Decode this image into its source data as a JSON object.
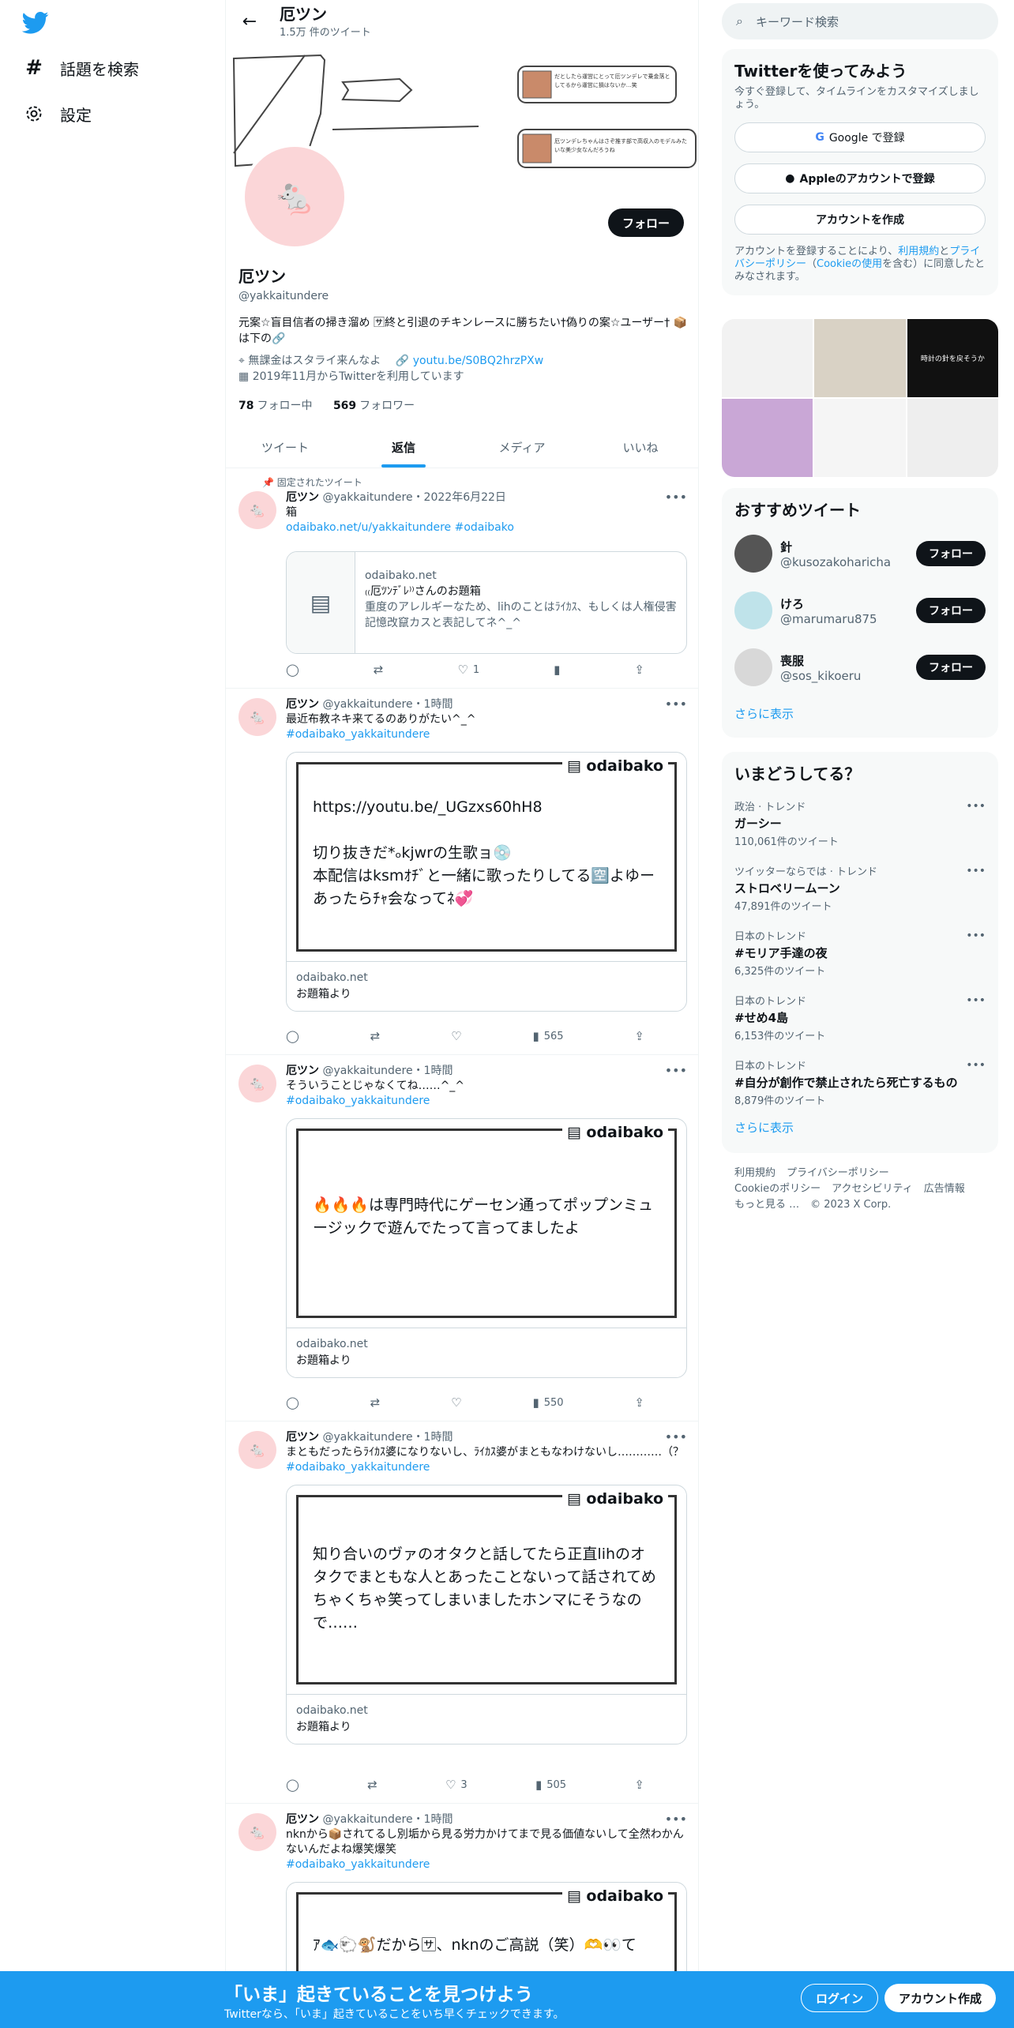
{
  "nav": {
    "explore_label": "話題を検索",
    "settings_label": "設定"
  },
  "header": {
    "name": "厄ツン",
    "tweet_count": "1.5万 件のツイート"
  },
  "profile": {
    "avatar_glyph": "🐁",
    "follow_label": "フォロー",
    "name": "厄ツン",
    "handle": "@yakkaitundere",
    "bio": "元案☆盲目信者の掃き溜め 🈂終と引退のチキンレースに勝ちたい†偽りの案☆ユーザー† 📦は下の🔗",
    "location": "無課金はスタライ来んなよ",
    "url": "youtu.be/S0BQ2hrzPXw",
    "joined": "2019年11月からTwitterを利用しています",
    "following_count": "78",
    "following_label": "フォロー中",
    "followers_count": "569",
    "followers_label": "フォロワー"
  },
  "banner": {
    "note1": "だとしたら運営にとって厄ツンデレで乗金落としてるから運営に損はないか…笑",
    "note2": "厄ツンデレちゃんはさぞ推す部で高収入のモデルみたいな美少女なんだろうね"
  },
  "tabs": [
    "ツイート",
    "返信",
    "メディア",
    "いいね"
  ],
  "pinned_label": "固定されたツイート",
  "tweets": [
    {
      "name": "厄ツン",
      "handle": "@yakkaitundere",
      "time": "・2022年6月22日",
      "text": "箱",
      "link": "odaibako.net/u/yakkaitundere",
      "tag": "#odaibako",
      "card_domain": "odaibako.net",
      "card_title": "₍₍厄ﾂﾝﾃﾞﾚ⁾⁾さんのお題箱",
      "card_desc": "重度のアレルギーなため、lihのことはﾗｲｶｽ、もしくは人権侵害記憶改竄カスと表記してネ^_^",
      "likes": "1"
    },
    {
      "name": "厄ツン",
      "handle": "@yakkaitundere",
      "time": "・1時間",
      "text": "最近布教ネキ来てるのありがたい^_^",
      "tag": "#odaibako_yakkaitundere",
      "brand": "odaibako",
      "ob_text": "https://youtu.be/_UGzxs60hH8\n\n切り抜きだ*ₒkjwrの生歌ョ💿\n本配信はksmｵﾁﾞと一緒に歌ったりしてる🈳よゆーあったらﾁｬ会なってﾈ💞",
      "card_domain": "odaibako.net",
      "card_title": "お題箱より",
      "views": "565"
    },
    {
      "name": "厄ツン",
      "handle": "@yakkaitundere",
      "time": "・1時間",
      "text": "そういうことじゃなくてね……^_^",
      "tag": "#odaibako_yakkaitundere",
      "brand": "odaibako",
      "ob_text": "🔥🔥🔥は専門時代にゲーセン通ってポップンミュージックで遊んでたって言ってましたよ",
      "card_domain": "odaibako.net",
      "card_title": "お題箱より",
      "views": "550"
    },
    {
      "name": "厄ツン",
      "handle": "@yakkaitundere",
      "time": "・1時間",
      "text": "まともだったらﾗｲｶｽ婆になりないし、ﾗｲｶｽ婆がまともなわけないし…………（？",
      "tag": "#odaibako_yakkaitundere",
      "brand": "odaibako",
      "ob_text": "知り合いのヴァのオタクと話してたら正直lihのオタクでまともな人とあったことないって話されてめちゃくちゃ笑ってしまいましたホンマにそうなので……",
      "card_domain": "odaibako.net",
      "card_title": "お題箱より",
      "likes": "3",
      "views": "505"
    },
    {
      "name": "厄ツン",
      "handle": "@yakkaitundere",
      "time": "・1時間",
      "text": "nknから📦されてるし別垢から見る労力かけてまで見る価値ないして全然わかんないんだよね爆笑爆笑",
      "tag": "#odaibako_yakkaitundere",
      "brand": "odaibako",
      "ob_text": "ｱ🐟🐑🐒だから🈂、nknのご高説（笑）🫶👀て"
    }
  ],
  "search": {
    "placeholder": "キーワード検索"
  },
  "signup_panel": {
    "title": "Twitterを使ってみよう",
    "subtitle": "今すぐ登録して、タイムラインをカスタマイズしましょう。",
    "google_label": "Google で登録",
    "apple_label": "Appleのアカウントで登録",
    "create_label": "アカウントを作成",
    "legal_1": "アカウントを登録することにより、",
    "legal_terms": "利用規約",
    "legal_2": "と",
    "legal_privacy": "プライバシーポリシー",
    "legal_3": "（",
    "legal_cookie": "Cookieの使用",
    "legal_4": "を含む）に同意したとみなされます。"
  },
  "media_tiles": [
    "時計の針を戻そうか"
  ],
  "recommend": {
    "title": "おすすめツイート",
    "users": [
      {
        "name": "針",
        "handle": "@kusozakoharicha",
        "follow": "フォロー"
      },
      {
        "name": "けろ",
        "handle": "@marumaru875",
        "follow": "フォロー"
      },
      {
        "name": "喪服",
        "handle": "@sos_kikoeru",
        "follow": "フォロー"
      }
    ],
    "more": "さらに表示"
  },
  "trends": {
    "title": "いまどうしてる？",
    "items": [
      {
        "cat": "政治 · トレンド",
        "title": "ガーシー",
        "count": "110,061件のツイート"
      },
      {
        "cat": "ツイッターならでは · トレンド",
        "title": "ストロベリームーン",
        "count": "47,891件のツイート"
      },
      {
        "cat": "日本のトレンド",
        "title": "#モリア手達の夜",
        "count": "6,325件のツイート"
      },
      {
        "cat": "日本のトレンド",
        "title": "#せめ4島",
        "count": "6,153件のツイート"
      },
      {
        "cat": "日本のトレンド",
        "title": "#自分が創作で禁止されたら死亡するもの",
        "count": "8,879件のツイート"
      }
    ],
    "more": "さらに表示"
  },
  "footer": {
    "terms": "利用規約",
    "privacy": "プライバシーポリシー",
    "cookie": "Cookieのポリシー",
    "access": "アクセシビリティ",
    "ads": "広告情報",
    "more": "もっと見る …",
    "copyright": "© 2023 X Corp."
  },
  "bottom": {
    "title": "「いま」起きていることを見つけよう",
    "subtitle": "Twitterなら、「いま」起きていることをいち早くチェックできます。",
    "login": "ログイン",
    "signup": "アカウント作成"
  },
  "colors": {
    "accent": "#1d9bf0",
    "dark": "#0f1419",
    "muted": "#536471",
    "avatar_bg": "#fbd6d8"
  }
}
